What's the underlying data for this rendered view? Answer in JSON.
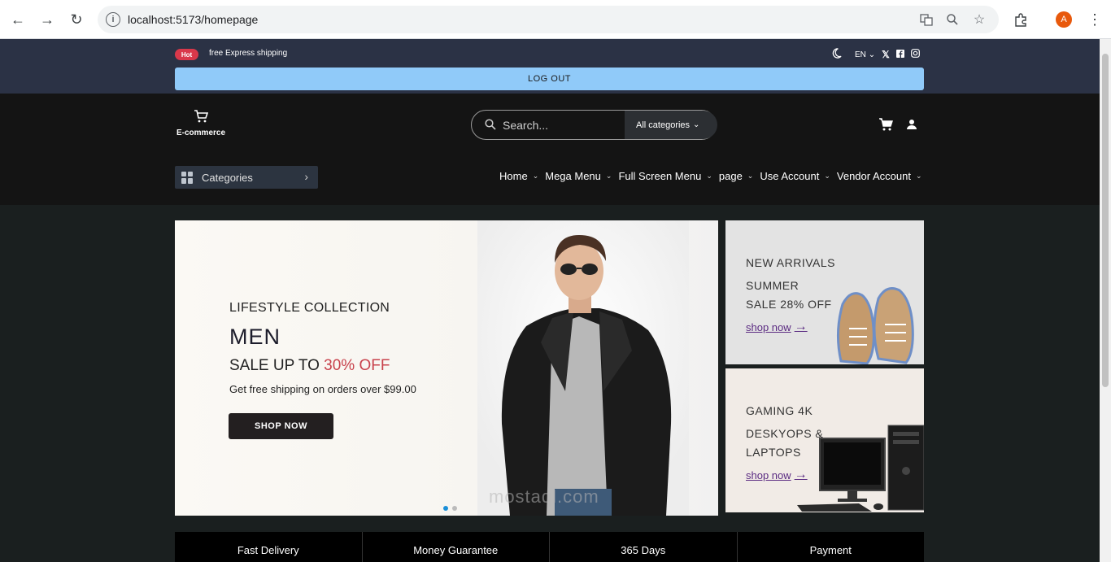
{
  "browser": {
    "url": "localhost:5173/homepage",
    "profile_initial": "A"
  },
  "topbar": {
    "hot_badge": "Hot",
    "shipping_text": "free Express shipping",
    "language": "EN",
    "logout_label": "LOG OUT"
  },
  "header": {
    "logo_text": "E-commerce",
    "search_placeholder": "Search...",
    "category_select": "All categories",
    "categories_button": "Categories",
    "menu": [
      "Home",
      "Mega Menu",
      "Full Screen Menu",
      "page",
      "Use Account",
      "Vendor Account"
    ]
  },
  "hero": {
    "subtitle": "LIFESTYLE COLLECTION",
    "title": "MEN",
    "sale_prefix": "SALE UP TO ",
    "sale_highlight": "30% OFF",
    "description": "Get free shipping on orders over $99.00",
    "button_label": "SHOP NOW",
    "highlight_color": "#c8424c"
  },
  "side_banners": [
    {
      "heading": "NEW ARRIVALS",
      "line1": "SUMMER",
      "line2": "SALE 28% OFF",
      "link": "shop now"
    },
    {
      "heading": "GAMING 4K",
      "line1": "DESKYOPS &",
      "line2": "LAPTOPS",
      "link": "shop now"
    }
  ],
  "features": [
    "Fast Delivery",
    "Money Guarantee",
    "365 Days",
    "Payment"
  ],
  "watermark": "mostaql.com",
  "colors": {
    "logout_bg": "#90caf9",
    "topbar_bg": "#2b3245",
    "header_bg": "#141414",
    "link_color": "#5b2b82"
  }
}
